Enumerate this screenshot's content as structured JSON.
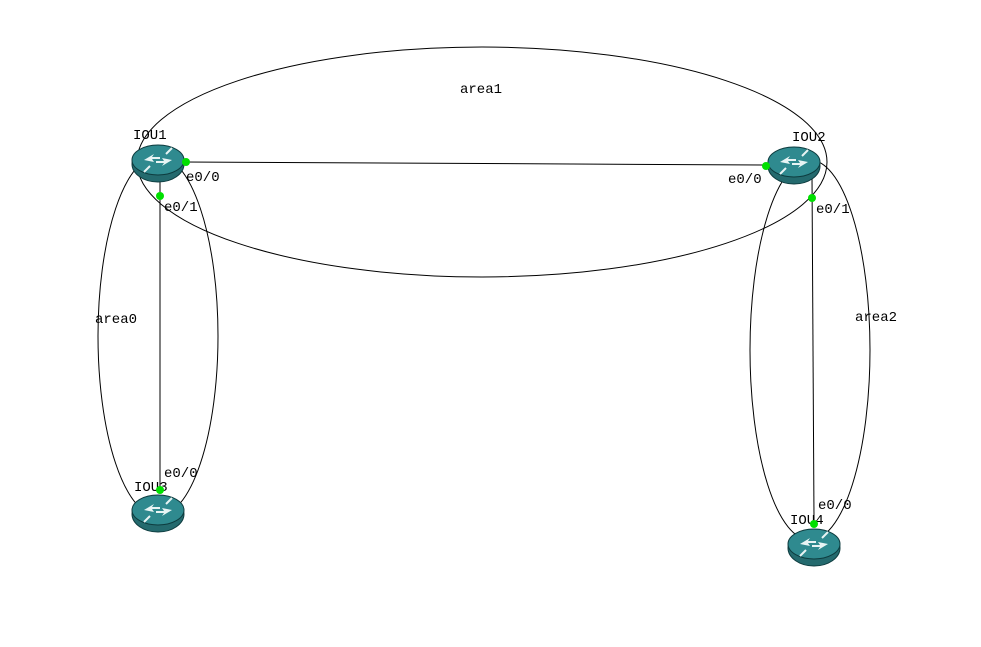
{
  "areas": {
    "top": "area1",
    "left": "area0",
    "right": "area2"
  },
  "devices": {
    "iou1": {
      "label": "IOU1",
      "ports": {
        "e00": "e0/0",
        "e01": "e0/1"
      }
    },
    "iou2": {
      "label": "IOU2",
      "ports": {
        "e00": "e0/0",
        "e01": "e0/1"
      }
    },
    "iou3": {
      "label": "IOU3",
      "ports": {
        "e00": "e0/0"
      }
    },
    "iou4": {
      "label": "IOU4",
      "ports": {
        "e00": "e0/0"
      }
    }
  },
  "topology": {
    "links": [
      {
        "from": "IOU1 e0/0",
        "to": "IOU2 e0/0",
        "area": "area1"
      },
      {
        "from": "IOU1 e0/1",
        "to": "IOU3 e0/0",
        "area": "area0"
      },
      {
        "from": "IOU2 e0/1",
        "to": "IOU4 e0/0",
        "area": "area2"
      }
    ]
  }
}
